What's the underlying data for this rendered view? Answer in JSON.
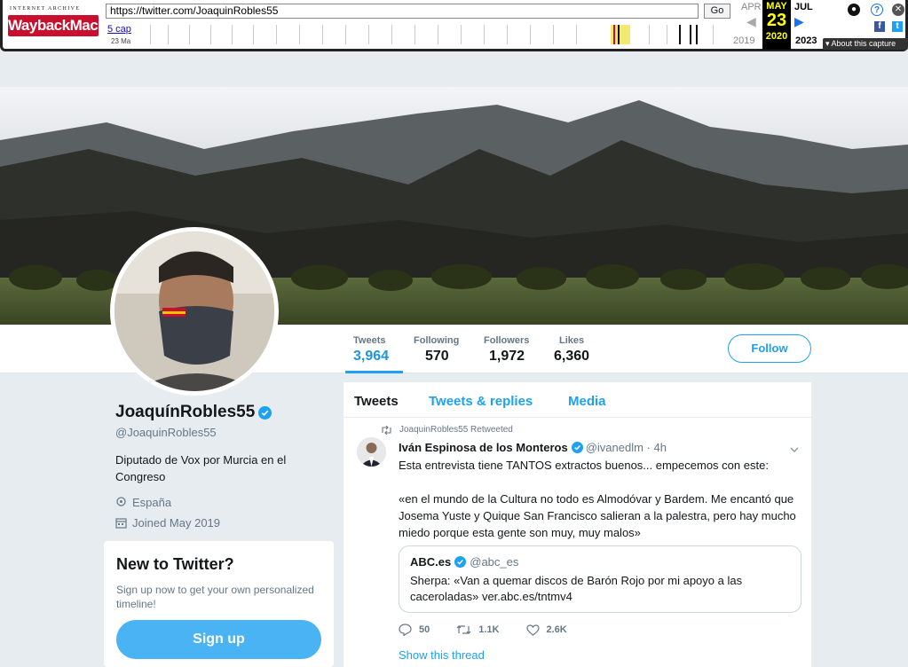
{
  "wayback": {
    "logo_top": "INTERNET ARCHIVE",
    "logo": "WaybackMachine",
    "url": "https://twitter.com/JoaquinRobles55",
    "go": "Go",
    "captures": "5 cap",
    "captures_date": "23 Ma",
    "months": {
      "prev": "APR",
      "cur": "MAY",
      "next": "JUL"
    },
    "day": "23",
    "years": {
      "prev": "2019",
      "cur": "2020",
      "next": "2023"
    },
    "about": "About this capture"
  },
  "profile": {
    "name": "JoaquínRobles55",
    "handle": "@JoaquinRobles55",
    "bio": "Diputado de Vox por Murcia en el Congreso",
    "location": "España",
    "joined": "Joined May 2019"
  },
  "stats": [
    {
      "label": "Tweets",
      "value": "3,964"
    },
    {
      "label": "Following",
      "value": "570"
    },
    {
      "label": "Followers",
      "value": "1,972"
    },
    {
      "label": "Likes",
      "value": "6,360"
    }
  ],
  "follow_label": "Follow",
  "signup": {
    "title": "New to Twitter?",
    "text": "Sign up now to get your own personalized timeline!",
    "button": "Sign up"
  },
  "tabs": [
    "Tweets",
    "Tweets & replies",
    "Media"
  ],
  "tweet": {
    "retweeted_by": "JoaquinRobles55 Retweeted",
    "author": "Iván Espinosa de los Monteros",
    "handle_time": "@ivanedlm · 4h",
    "text_1": "Esta entrevista tiene TANTOS extractos buenos... empecemos con este:",
    "text_2": "«en el mundo de la Cultura no todo es Almodóvar y Bardem. Me encantó que Josema Yuste y Quique San Francisco salieran a la palestra, pero hay mucho miedo porque esta gente son muy, muy malos»",
    "quote": {
      "author": "ABC.es",
      "handle": "@abc_es",
      "text": "Sherpa: «Van a quemar discos de Barón Rojo por mi apoyo a las caceroladas» ver.abc.es/tntmv4"
    },
    "replies": "50",
    "retweets": "1.1K",
    "likes": "2.6K",
    "show_thread": "Show this thread"
  },
  "colors": {
    "accent": "#1da1f2",
    "wayback_red": "#c8102e"
  }
}
